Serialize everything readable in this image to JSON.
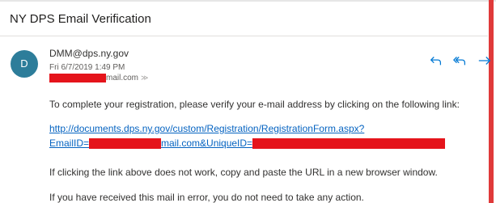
{
  "header": {
    "title": "NY DPS Email Verification"
  },
  "message": {
    "avatar_initial": "D",
    "sender": "DMM@dps.ny.gov",
    "date": "Fri 6/7/2019 1:49 PM",
    "to_suffix": "mail.com",
    "expand_glyph": "≫",
    "body": {
      "intro": "To complete your registration, please verify your e-mail address by clicking on the following link:",
      "link_line1": "http://documents.dps.ny.gov/custom/Registration/RegistrationForm.aspx?",
      "link_part_a": "EmailID=",
      "link_part_b": "mail.com&UniqueID=",
      "copy_paste": "If clicking the link above does not work, copy and paste the URL in a new browser window.",
      "error_note": "If you have received this mail in error, you do not need to take any action."
    }
  },
  "actions": {
    "icons": [
      "reply-icon",
      "reply-all-icon",
      "forward-icon"
    ]
  },
  "colors": {
    "accent": "#0078d4",
    "link": "#0563c1",
    "redaction": "#e5141b",
    "avatar": "#2d7d9a"
  }
}
